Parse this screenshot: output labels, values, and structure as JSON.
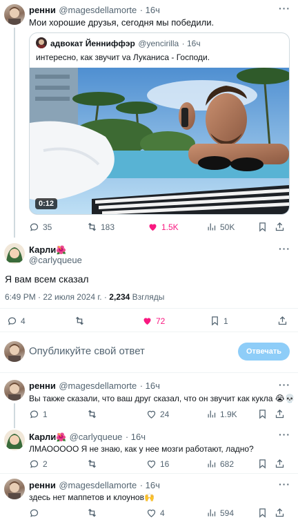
{
  "tweet1": {
    "name": "ренни",
    "handle": "@magesdellamorte",
    "time": "· 16ч",
    "text": "Мои хорошие друзья, сегодня мы победили.",
    "quote": {
      "name": "адвокат Йенниффэр",
      "handle": "@yencirilla",
      "time": "· 16ч",
      "text": "интересно, как звучит va Луканиса - Господи.",
      "video_time": "0:12"
    },
    "stats": {
      "replies": "35",
      "reposts": "183",
      "likes": "1.5K",
      "views": "50K"
    }
  },
  "main": {
    "name": "Карли",
    "name_emoji": "🌺",
    "handle": "@carlyqueue",
    "text": "Я вам всем сказал",
    "meta_time": "6:49 PM · 22 июля 2024 г. ·",
    "views_count": "2,234",
    "views_label": "Взгляды",
    "stats": {
      "replies": "4",
      "likes": "72",
      "bookmarks": "1"
    }
  },
  "composer": {
    "placeholder": "Опубликуйте свой ответ",
    "button": "Отвечать"
  },
  "reply1": {
    "name": "ренни",
    "handle": "@magesdellamorte",
    "time": "· 16ч",
    "text": "Вы также сказали, что ваш друг сказал, что он звучит как кукла",
    "emoji": "😭💀",
    "stats": {
      "replies": "1",
      "likes": "24",
      "views": "1.9K"
    }
  },
  "reply2": {
    "name": "Карли",
    "name_emoji": "🌺",
    "handle": "@carlyqueue",
    "time": "· 16ч",
    "text": "ЛМАООООО Я не знаю, как у нее мозги работают, ладно?",
    "stats": {
      "replies": "2",
      "likes": "16",
      "views": "682"
    }
  },
  "reply3": {
    "name": "ренни",
    "handle": "@magesdellamorte",
    "time": "· 16ч",
    "text": "здесь нет маппетов и клоунов",
    "emoji": "🙌",
    "stats": {
      "likes": "4",
      "views": "594"
    }
  },
  "more_label": "···",
  "colors": {
    "like": "#f91880",
    "accent": "#1d9bf0",
    "button_disabled": "#8ecdf8",
    "thread": "#cfd9de"
  }
}
